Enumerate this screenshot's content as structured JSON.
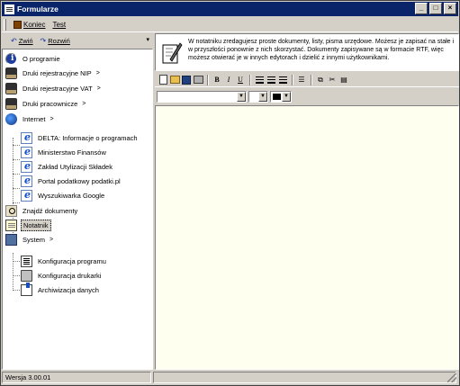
{
  "window": {
    "title": "Formularze",
    "buttons": {
      "minimize": "_",
      "maximize": "□",
      "close": "×"
    }
  },
  "menu": {
    "items": [
      {
        "label": "Koniec",
        "icon": "exit-icon"
      },
      {
        "label": "Test"
      }
    ]
  },
  "left_toolbar": {
    "collapse_label": "Zwiń",
    "expand_label": "Rozwiń",
    "chevron": "▾"
  },
  "tree": [
    {
      "label": "O programie",
      "icon": "info-icon",
      "level": 0
    },
    {
      "label": "Druki rejestracyjne NIP",
      "icon": "folder-icon",
      "level": 0,
      "chevron": ">"
    },
    {
      "label": "Druki rejestracyjne VAT",
      "icon": "folder-icon",
      "level": 0,
      "chevron": ">"
    },
    {
      "label": "Druki pracownicze",
      "icon": "folder-icon",
      "level": 0,
      "chevron": ">"
    },
    {
      "label": "Internet",
      "icon": "internet-icon",
      "level": 0,
      "chevron": ">"
    },
    {
      "label": "DELTA: Informacje o programach",
      "icon": "web-icon",
      "level": 1
    },
    {
      "label": "Ministerstwo Finansów",
      "icon": "web-icon",
      "level": 1
    },
    {
      "label": "Zakład Utylizacji Składek",
      "icon": "web-icon",
      "level": 1
    },
    {
      "label": "Portal podatkowy podatki.pl",
      "icon": "web-icon",
      "level": 1
    },
    {
      "label": "Wyszukiwarka Google",
      "icon": "web-icon",
      "level": 1
    },
    {
      "label": "Znajdź dokumenty",
      "icon": "search-icon",
      "level": 0
    },
    {
      "label": "Notatnik",
      "icon": "notepad-icon",
      "level": 0,
      "selected": true
    },
    {
      "label": "System",
      "icon": "system-icon",
      "level": 0,
      "chevron": ">"
    },
    {
      "label": "Konfiguracja programu",
      "icon": "config-icon",
      "level": 1
    },
    {
      "label": "Konfiguracja drukarki",
      "icon": "printer-icon",
      "level": 1
    },
    {
      "label": "Archiwizacja danych",
      "icon": "archive-icon",
      "level": 1
    }
  ],
  "info": {
    "text": "W notatniku zredagujesz proste dokumenty, listy, pisma urzędowe. Możesz je zapisać na stałe i w przyszłości ponownie z nich skorzystać. Dokumenty zapisywane są w formacie RTF, więc możesz otwierać je w innych edytorach i dzielić z innymi użytkownikami."
  },
  "toolbar": {
    "bold": "B",
    "italic": "I",
    "underline": "U",
    "icons": [
      "new-icon",
      "open-icon",
      "save-icon",
      "print-icon",
      "bold-icon",
      "italic-icon",
      "underline-icon",
      "align-left-icon",
      "align-center-icon",
      "align-right-icon",
      "bullets-icon",
      "copy-icon",
      "cut-icon",
      "paste-icon"
    ]
  },
  "format_bar": {
    "font_value": "",
    "size_value": "",
    "color": "#000000"
  },
  "editor": {
    "content": ""
  },
  "status": {
    "version": "Wersja 3.00.01"
  },
  "colors": {
    "titlebar": "#0a246a",
    "face": "#d4d0c8",
    "editor_bg": "#fffff0",
    "selection": "#d4d0c8"
  }
}
